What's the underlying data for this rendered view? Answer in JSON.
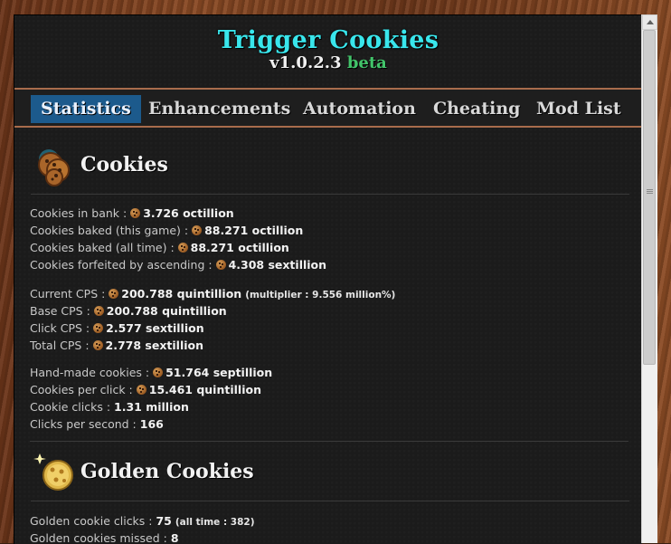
{
  "header": {
    "title": "Trigger Cookies",
    "version": "v1.0.2.3",
    "beta": "beta"
  },
  "tabs": [
    {
      "label": "Statistics",
      "active": true
    },
    {
      "label": "Enhancements",
      "active": false
    },
    {
      "label": "Automation",
      "active": false
    },
    {
      "label": "Cheating",
      "active": false
    },
    {
      "label": "Mod List",
      "active": false
    }
  ],
  "cookies": {
    "title": "Cookies",
    "group1": [
      {
        "label": "Cookies in bank : ",
        "value": "3.726 octillion"
      },
      {
        "label": "Cookies baked (this game) : ",
        "value": "88.271 octillion"
      },
      {
        "label": "Cookies baked (all time) : ",
        "value": "88.271 octillion"
      },
      {
        "label": "Cookies forfeited by ascending : ",
        "value": "4.308 sextillion"
      }
    ],
    "group2": [
      {
        "label": "Current CPS : ",
        "value": "200.788 quintillion",
        "extra": "(multiplier : 9.556 million%)"
      },
      {
        "label": "Base CPS : ",
        "value": "200.788 quintillion"
      },
      {
        "label": "Click CPS : ",
        "value": "2.577 sextillion"
      },
      {
        "label": "Total CPS : ",
        "value": "2.778 sextillion"
      }
    ],
    "group3": [
      {
        "label": "Hand-made cookies : ",
        "value": "51.764 septillion"
      },
      {
        "label": "Cookies per click : ",
        "value": "15.461 quintillion"
      },
      {
        "label": "Cookie clicks : ",
        "value": "1.31 million"
      },
      {
        "label": "Clicks per second : ",
        "value": "166"
      }
    ]
  },
  "golden": {
    "title": "Golden Cookies",
    "lines": [
      {
        "label": "Golden cookie clicks : ",
        "value": "75",
        "extra": "(all time : 382)"
      },
      {
        "label": "Golden cookies missed : ",
        "value": "8"
      }
    ]
  },
  "icons": {
    "cookies_section": "cookie-stack-icon",
    "golden_section": "golden-cookie-icon",
    "inline": "cookie-icon"
  },
  "colors": {
    "title": "#39e6ec",
    "beta": "#42c46a",
    "active_tab": "#1c5a8c",
    "frame": "#7a3f1f"
  }
}
